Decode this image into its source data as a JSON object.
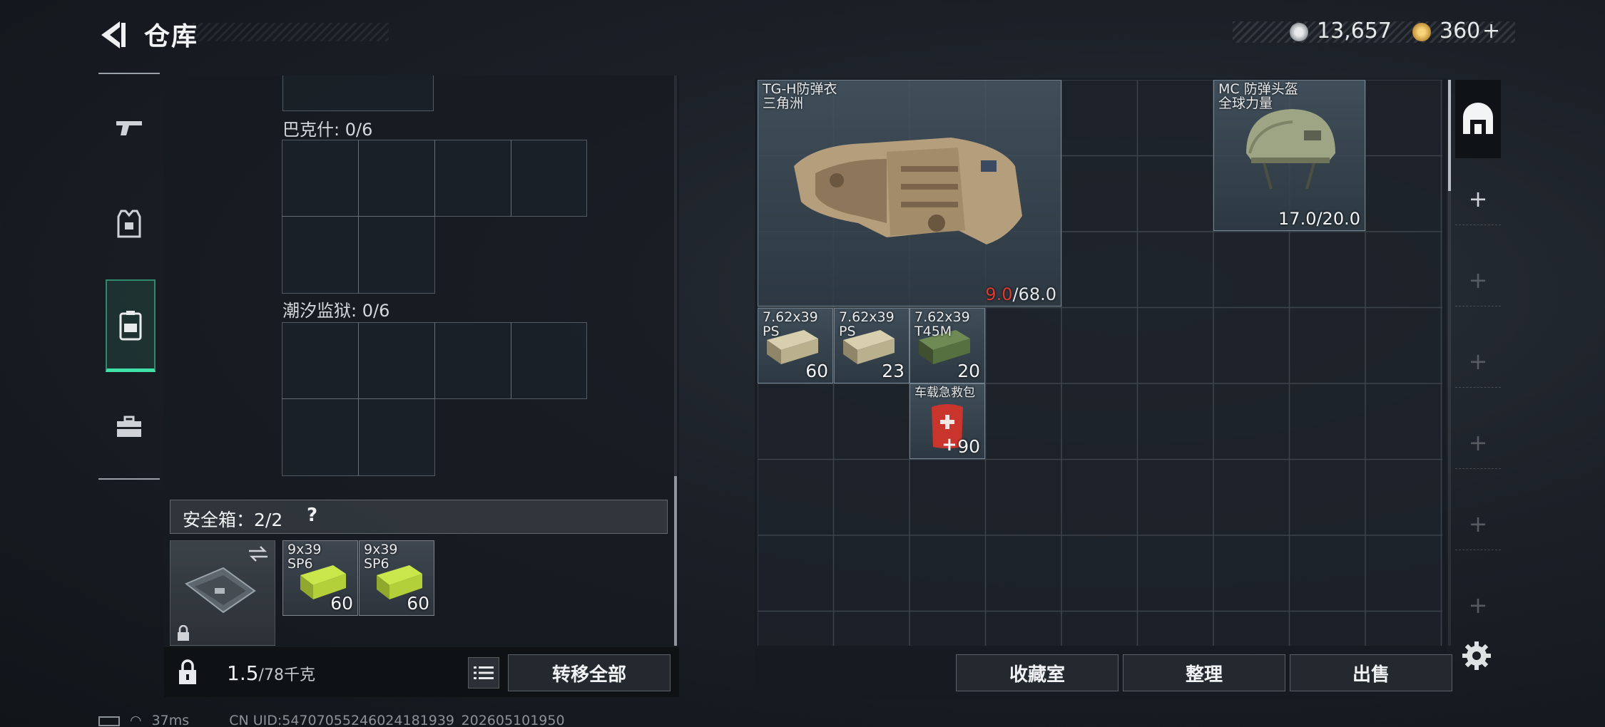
{
  "header": {
    "title": "仓库",
    "currency_1": "13,657",
    "currency_2": "360",
    "currency_2_add": "+"
  },
  "left_nav": {
    "items": [
      {
        "name": "weapons",
        "icon": "gun-icon"
      },
      {
        "name": "armor",
        "icon": "armor-vest-icon"
      },
      {
        "name": "backpack",
        "icon": "backpack-icon",
        "active": true
      },
      {
        "name": "case",
        "icon": "toolbox-icon"
      }
    ]
  },
  "loadout": {
    "section_1_label": "巴克什: 0/6",
    "section_2_label": "潮汐监狱: 0/6",
    "safe_box_label": "安全箱：2/2",
    "safe_box_help": "?",
    "safe_box_items": [
      {
        "name_line1": "9x39",
        "name_line2": "SP6",
        "count": "60"
      },
      {
        "name_line1": "9x39",
        "name_line2": "SP6",
        "count": "60"
      }
    ]
  },
  "left_footer": {
    "weight_current": "1.5",
    "weight_max": "/78千克",
    "transfer_all_label": "转移全部"
  },
  "stash": {
    "items": [
      {
        "name_line1": "TG-H防弹衣",
        "name_line2": "三角洲",
        "durability_current": "9.0",
        "durability_max": "/68.0"
      },
      {
        "name_line1": "MC 防弹头盔",
        "name_line2": "全球力量",
        "durability": "17.0/20.0"
      },
      {
        "name_line1": "7.62x39",
        "name_line2": "PS",
        "count": "60"
      },
      {
        "name_line1": "7.62x39",
        "name_line2": "PS",
        "count": "23"
      },
      {
        "name_line1": "7.62x39",
        "name_line2": "T45M",
        "count": "20"
      },
      {
        "name_line1": "车载急救包",
        "count": "90"
      }
    ]
  },
  "stash_footer": {
    "collection_label": "收藏室",
    "sort_label": "整理",
    "sell_label": "出售"
  },
  "status_bar": {
    "ping": "37ms",
    "uid": "CN UID:54707055246024181939_202605101950"
  },
  "colors": {
    "accent_green": "#3fe1a9",
    "durability_low": "#e0392f"
  }
}
